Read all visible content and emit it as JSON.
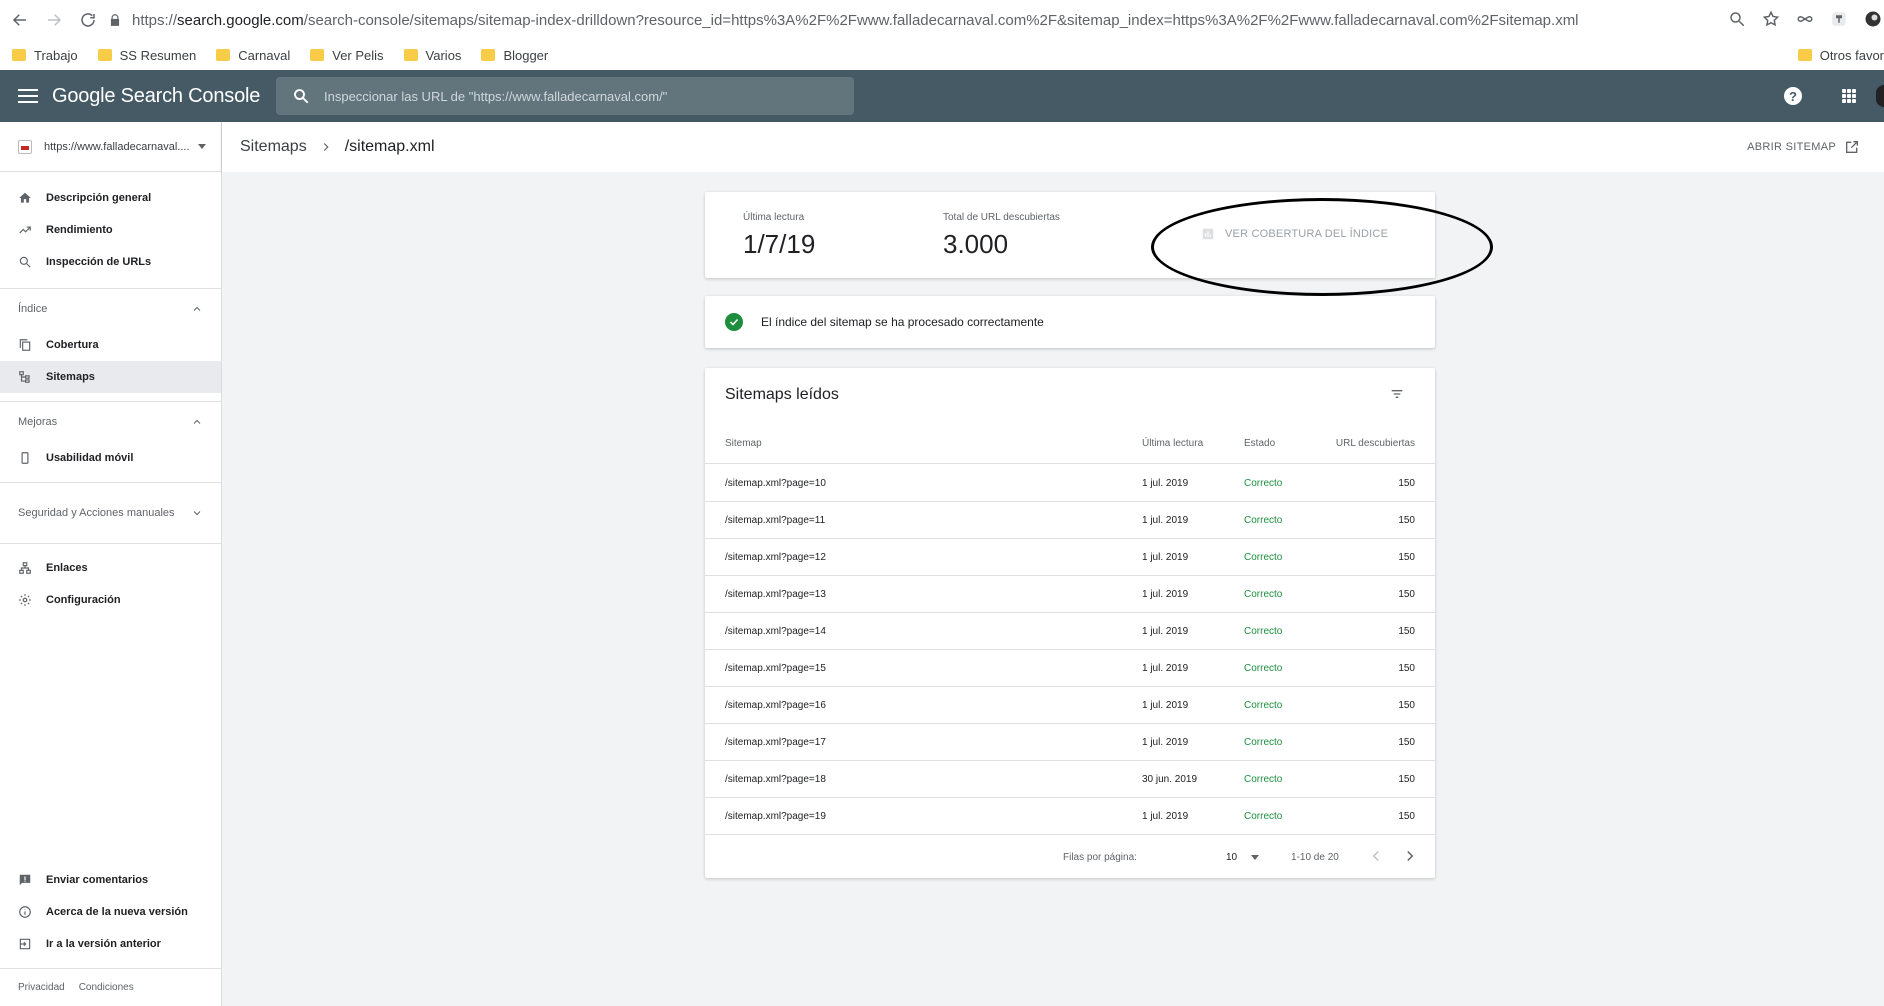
{
  "browser": {
    "url_scheme": "https://",
    "url_host": "search.google.com",
    "url_path": "/search-console/sitemaps/sitemap-index-drilldown?resource_id=https%3A%2F%2Fwww.falladecarnaval.com%2F&sitemap_index=https%3A%2F%2Fwww.falladecarnaval.com%2Fsitemap.xml",
    "bookmarks": [
      "Trabajo",
      "SS Resumen",
      "Carnaval",
      "Ver Pelis",
      "Varios",
      "Blogger"
    ],
    "other_bookmarks": "Otros favor"
  },
  "header": {
    "product_name": "Google Search Console",
    "search_placeholder": "Inspeccionar las URL de \"https://www.falladecarnaval.com/\"",
    "help_label": "?"
  },
  "sidebar": {
    "property": "https://www.falladecarnaval....",
    "top_items": [
      "Descripción general",
      "Rendimiento",
      "Inspección de URLs"
    ],
    "index_section": "Índice",
    "index_items": [
      "Cobertura",
      "Sitemaps"
    ],
    "improvements_section": "Mejoras",
    "improvements_items": [
      "Usabilidad móvil"
    ],
    "security_section": "Seguridad y Acciones manuales",
    "other_items": [
      "Enlaces",
      "Configuración"
    ],
    "bottom_items": [
      "Enviar comentarios",
      "Acerca de la nueva versión",
      "Ir a la versión anterior"
    ],
    "footer_links": [
      "Privacidad",
      "Condiciones"
    ]
  },
  "titlebar": {
    "crumb_parent": "Sitemaps",
    "crumb_current": "/sitemap.xml",
    "open_sitemap": "ABRIR SITEMAP"
  },
  "stats": {
    "last_read_label": "Última lectura",
    "last_read_value": "1/7/19",
    "total_urls_label": "Total de URL descubiertas",
    "total_urls_value": "3.000",
    "coverage_button": "VER COBERTURA DEL ÍNDICE"
  },
  "status": {
    "message": "El índice del sitemap se ha procesado correctamente"
  },
  "table": {
    "title": "Sitemaps leídos",
    "columns": [
      "Sitemap",
      "Última lectura",
      "Estado",
      "URL descubiertas"
    ],
    "rows": [
      {
        "sitemap": "/sitemap.xml?page=10",
        "date": "1 jul. 2019",
        "state": "Correcto",
        "urls": "150"
      },
      {
        "sitemap": "/sitemap.xml?page=11",
        "date": "1 jul. 2019",
        "state": "Correcto",
        "urls": "150"
      },
      {
        "sitemap": "/sitemap.xml?page=12",
        "date": "1 jul. 2019",
        "state": "Correcto",
        "urls": "150"
      },
      {
        "sitemap": "/sitemap.xml?page=13",
        "date": "1 jul. 2019",
        "state": "Correcto",
        "urls": "150"
      },
      {
        "sitemap": "/sitemap.xml?page=14",
        "date": "1 jul. 2019",
        "state": "Correcto",
        "urls": "150"
      },
      {
        "sitemap": "/sitemap.xml?page=15",
        "date": "1 jul. 2019",
        "state": "Correcto",
        "urls": "150"
      },
      {
        "sitemap": "/sitemap.xml?page=16",
        "date": "1 jul. 2019",
        "state": "Correcto",
        "urls": "150"
      },
      {
        "sitemap": "/sitemap.xml?page=17",
        "date": "1 jul. 2019",
        "state": "Correcto",
        "urls": "150"
      },
      {
        "sitemap": "/sitemap.xml?page=18",
        "date": "30 jun. 2019",
        "state": "Correcto",
        "urls": "150"
      },
      {
        "sitemap": "/sitemap.xml?page=19",
        "date": "1 jul. 2019",
        "state": "Correcto",
        "urls": "150"
      }
    ],
    "rows_per_page_label": "Filas por página:",
    "rows_per_page": "10",
    "range": "1-10 de 20"
  },
  "colors": {
    "header_bg": "#455a64",
    "success_green": "#1e8e3e",
    "annotation": "#000000"
  }
}
